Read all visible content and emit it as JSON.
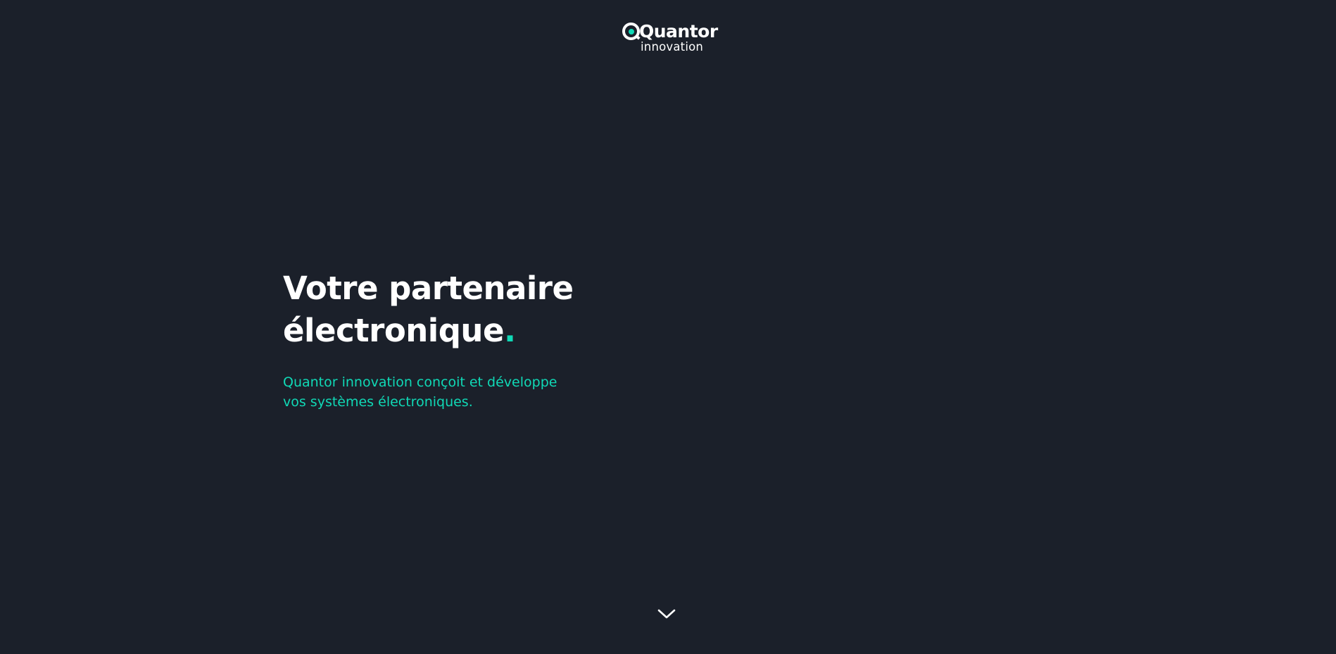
{
  "logo": {
    "name": "Quantor",
    "tagline": "innovation"
  },
  "hero": {
    "title_line1": "Votre partenaire",
    "title_line2": "électronique",
    "title_dot": ".",
    "subtitle_line1": "Quantor innovation conçoit et développe",
    "subtitle_line2": "vos systèmes électroniques."
  },
  "scroll": {
    "icon": "chevron-down-icon"
  },
  "colors": {
    "background": "#1b202a",
    "accent": "#10d9b6",
    "text": "#ffffff"
  }
}
